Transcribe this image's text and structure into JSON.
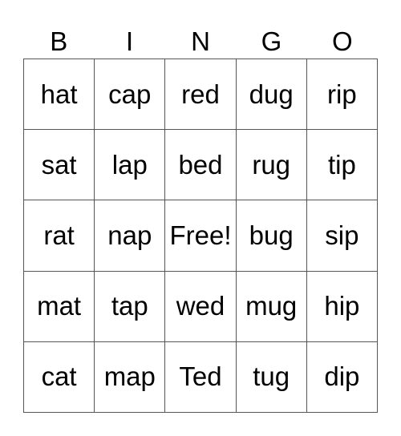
{
  "header": [
    "B",
    "I",
    "N",
    "G",
    "O"
  ],
  "cells": [
    [
      "hat",
      "cap",
      "red",
      "dug",
      "rip"
    ],
    [
      "sat",
      "lap",
      "bed",
      "rug",
      "tip"
    ],
    [
      "rat",
      "nap",
      "Free!",
      "bug",
      "sip"
    ],
    [
      "mat",
      "tap",
      "wed",
      "mug",
      "hip"
    ],
    [
      "cat",
      "map",
      "Ted",
      "tug",
      "dip"
    ]
  ]
}
